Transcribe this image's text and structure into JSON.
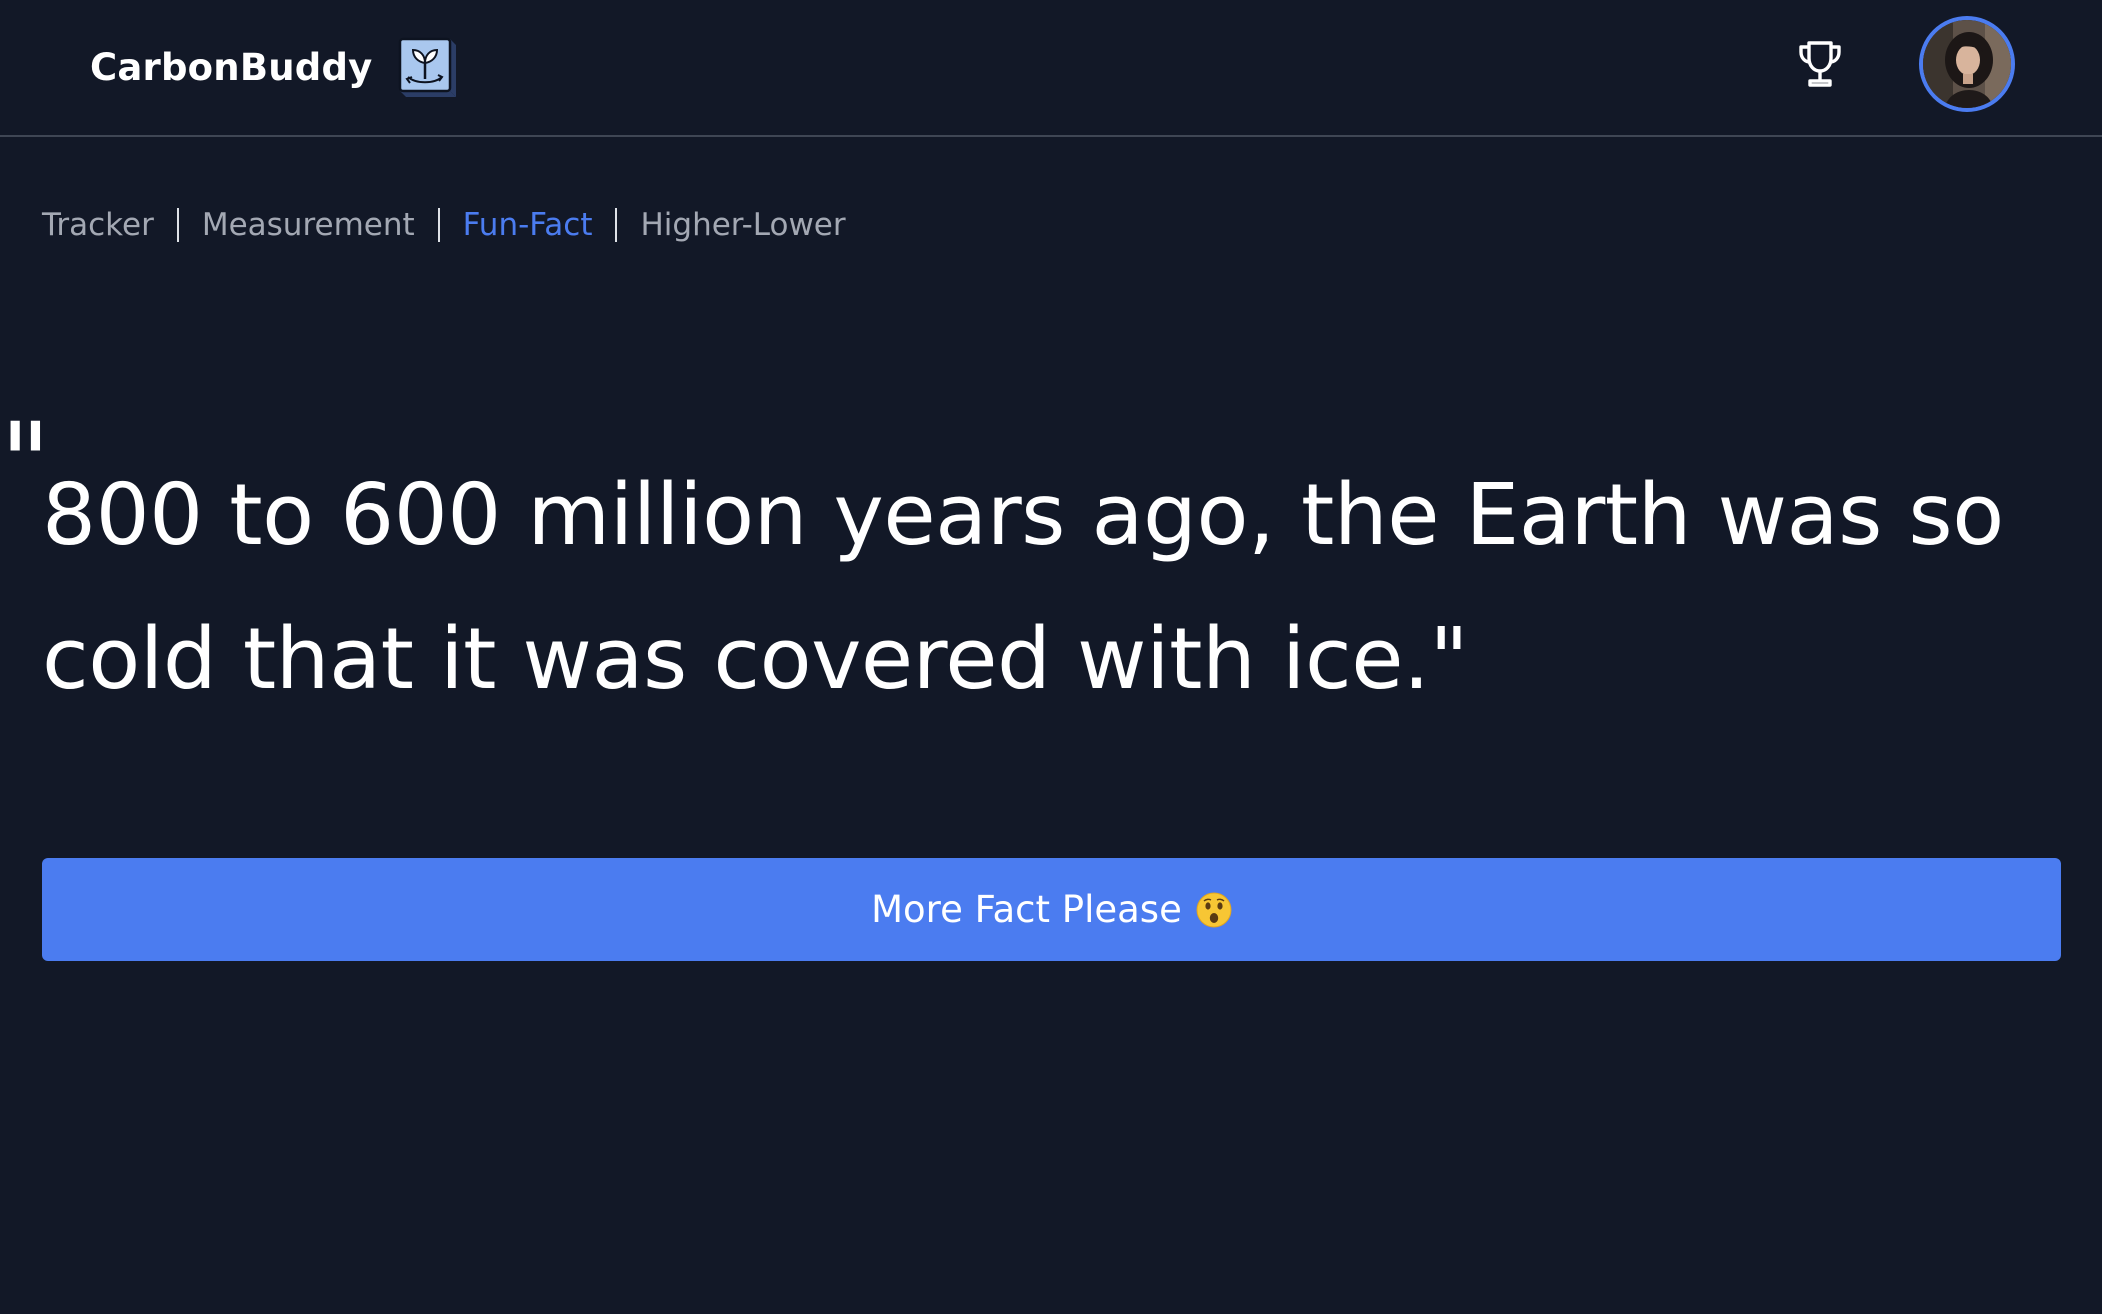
{
  "header": {
    "brand_name": "CarbonBuddy"
  },
  "tabs": [
    {
      "label": "Tracker",
      "active": false
    },
    {
      "label": "Measurement",
      "active": false
    },
    {
      "label": "Fun-Fact",
      "active": true
    },
    {
      "label": "Higher-Lower",
      "active": false
    }
  ],
  "fact": {
    "open_quote": "\"",
    "text": "800 to 600 million years ago, the Earth was so cold that it was covered with ice.\""
  },
  "button": {
    "label": "More Fact Please",
    "emoji_icon": "astonished-face-icon"
  },
  "colors": {
    "background": "#121827",
    "accent": "#4b7cf0",
    "muted_text": "#a3a8b3"
  }
}
